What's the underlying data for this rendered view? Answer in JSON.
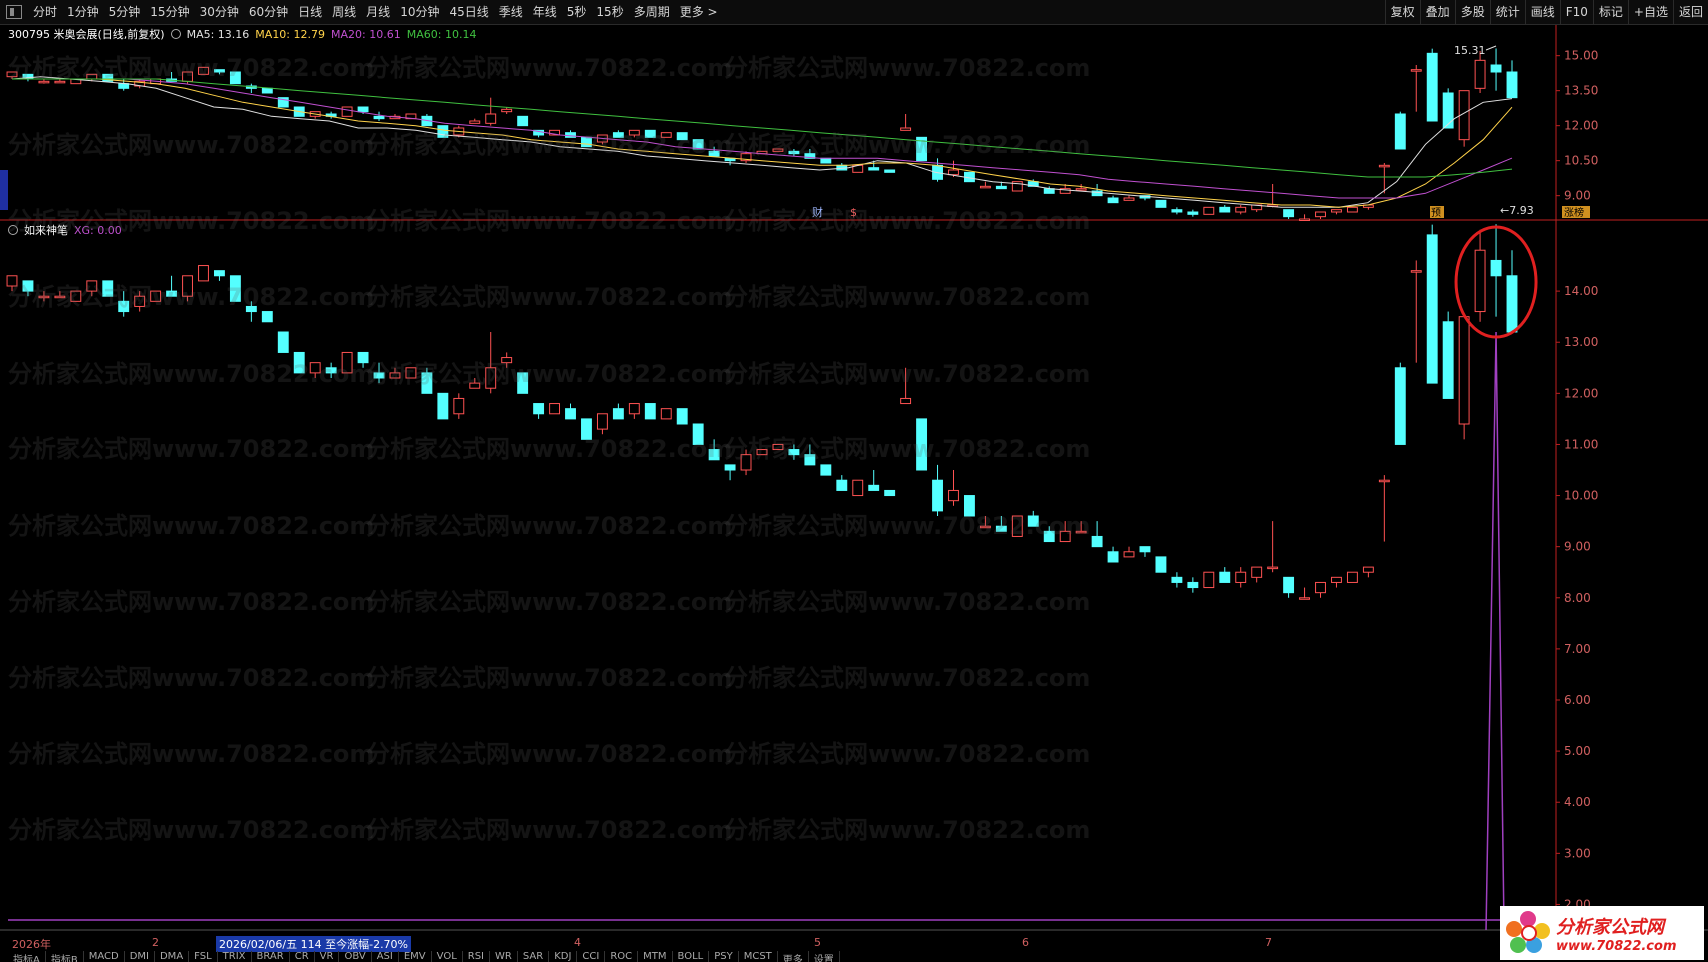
{
  "toolbar": {
    "periods": [
      "分时",
      "1分钟",
      "5分钟",
      "15分钟",
      "30分钟",
      "60分钟",
      "日线",
      "周线",
      "月线",
      "10分钟",
      "45日线",
      "季线",
      "年线",
      "5秒",
      "15秒",
      "多周期",
      "更多 >"
    ],
    "right": [
      "复权",
      "叠加",
      "多股",
      "统计",
      "画线",
      "F10",
      "标记",
      "+自选",
      "返回"
    ]
  },
  "stock": {
    "title": "300795 米奥会展(日线,前复权)",
    "ma5": "MA5: 13.16",
    "ma10": "MA10: 12.79",
    "ma20": "MA20: 10.61",
    "ma60": "MA60: 10.14"
  },
  "indicator": {
    "name": "如来神笔",
    "xg": "XG: 0.00"
  },
  "colors": {
    "up": "#ff5252",
    "down": "#54ffff",
    "ma5": "#e0e0e0",
    "ma10": "#ffd24a",
    "ma20": "#c050d0",
    "ma60": "#40c040",
    "grid": "#c02020",
    "purple": "#a040c0"
  },
  "annotations": {
    "high": "15.31",
    "low": "7.93",
    "cai": "财",
    "dollar": "$",
    "yu": "预",
    "zhangbang": "涨榜"
  },
  "date_strip": {
    "year": "2026年",
    "crosshair": "2026/02/06/五 114 至今涨幅-2.70%",
    "months": [
      "2",
      "4",
      "5",
      "6",
      "7"
    ]
  },
  "bottom_tabs": [
    "指标A",
    "指标B",
    "MACD",
    "DMI",
    "DMA",
    "FSL",
    "TRIX",
    "BRAR",
    "CR",
    "VR",
    "OBV",
    "ASI",
    "EMV",
    "VOL",
    "RSI",
    "WR",
    "SAR",
    "KDJ",
    "CCI",
    "ROC",
    "MTM",
    "BOLL",
    "PSY",
    "MCST",
    "更多",
    "设置"
  ],
  "logo": {
    "name": "分析家公式网",
    "url": "www.70822.com"
  },
  "watermark": "分析家公式网www.70822.com",
  "chart_data": [
    {
      "type": "candlestick",
      "ylim": [
        8.3,
        15.5
      ],
      "yticks": [
        "15.00",
        "13.50",
        "12.00",
        "10.50",
        "9.00"
      ],
      "series": [
        {
          "name": "MA5",
          "values": [
            14.0,
            14.1,
            14.0,
            13.9,
            13.8,
            13.6,
            13.2,
            12.8,
            12.7,
            12.4,
            12.3,
            12.2,
            11.9,
            11.9,
            11.8,
            11.6,
            11.5,
            11.4,
            11.3,
            11.1,
            11.0,
            10.9,
            10.7,
            10.6,
            10.5,
            10.4,
            10.3,
            10.2,
            10.1,
            10.2,
            10.5,
            10.4,
            10.0,
            9.8,
            9.6,
            9.5,
            9.3,
            9.2,
            9.1,
            9.0,
            8.9,
            8.8,
            8.7,
            8.6,
            8.5,
            8.5,
            8.5,
            8.7,
            9.6,
            11.2,
            12.3,
            13.0,
            13.16
          ]
        },
        {
          "name": "MA10",
          "values": [
            14.0,
            14.0,
            14.0,
            14.0,
            13.9,
            13.8,
            13.6,
            13.3,
            13.0,
            12.8,
            12.6,
            12.4,
            12.2,
            12.1,
            12.0,
            11.8,
            11.7,
            11.6,
            11.4,
            11.3,
            11.2,
            11.0,
            10.9,
            10.8,
            10.7,
            10.6,
            10.5,
            10.4,
            10.3,
            10.3,
            10.4,
            10.4,
            10.3,
            10.1,
            9.9,
            9.7,
            9.5,
            9.4,
            9.2,
            9.1,
            9.0,
            8.9,
            8.8,
            8.7,
            8.6,
            8.6,
            8.5,
            8.6,
            8.9,
            9.5,
            10.4,
            11.4,
            12.79
          ]
        },
        {
          "name": "MA20",
          "values": [
            14.0,
            14.0,
            14.0,
            14.0,
            14.0,
            13.9,
            13.8,
            13.6,
            13.4,
            13.2,
            13.0,
            12.8,
            12.6,
            12.4,
            12.3,
            12.1,
            12.0,
            11.9,
            11.8,
            11.6,
            11.5,
            11.4,
            11.3,
            11.1,
            11.0,
            10.9,
            10.8,
            10.7,
            10.6,
            10.6,
            10.6,
            10.5,
            10.4,
            10.3,
            10.2,
            10.1,
            10.0,
            9.9,
            9.7,
            9.6,
            9.5,
            9.4,
            9.3,
            9.2,
            9.1,
            9.0,
            8.9,
            8.9,
            8.9,
            9.1,
            9.6,
            10.1,
            10.61
          ]
        },
        {
          "name": "MA60",
          "values": [
            14.0,
            14.0,
            14.0,
            14.0,
            14.0,
            14.0,
            13.9,
            13.8,
            13.7,
            13.6,
            13.5,
            13.4,
            13.3,
            13.2,
            13.1,
            13.0,
            12.9,
            12.8,
            12.7,
            12.6,
            12.5,
            12.4,
            12.3,
            12.2,
            12.1,
            12.0,
            11.9,
            11.8,
            11.7,
            11.6,
            11.5,
            11.4,
            11.3,
            11.2,
            11.1,
            11.0,
            10.9,
            10.8,
            10.7,
            10.6,
            10.5,
            10.4,
            10.3,
            10.2,
            10.1,
            10.0,
            9.9,
            9.8,
            9.8,
            9.8,
            9.9,
            10.0,
            10.14
          ]
        }
      ]
    },
    {
      "type": "candlestick",
      "ylim": [
        1.5,
        15.0
      ],
      "yticks": [
        "14.00",
        "13.00",
        "12.00",
        "11.00",
        "10.00",
        "9.00",
        "8.00",
        "7.00",
        "6.00",
        "5.00",
        "4.00",
        "3.00",
        "2.00"
      ]
    }
  ],
  "candles": [
    [
      14.1,
      14.3,
      14.0,
      14.3
    ],
    [
      14.2,
      14.2,
      13.9,
      14.0
    ],
    [
      13.9,
      14.0,
      13.8,
      13.9
    ],
    [
      13.9,
      14.0,
      13.9,
      13.9
    ],
    [
      13.8,
      14.0,
      13.8,
      14.0
    ],
    [
      14.0,
      14.2,
      13.9,
      14.2
    ],
    [
      14.2,
      14.2,
      13.9,
      13.9
    ],
    [
      13.8,
      14.0,
      13.5,
      13.6
    ],
    [
      13.7,
      14.0,
      13.6,
      13.9
    ],
    [
      13.8,
      14.0,
      13.8,
      14.0
    ],
    [
      14.0,
      14.3,
      13.9,
      13.9
    ],
    [
      13.9,
      14.3,
      13.8,
      14.3
    ],
    [
      14.2,
      14.5,
      14.2,
      14.5
    ],
    [
      14.4,
      14.4,
      14.2,
      14.3
    ],
    [
      14.3,
      14.3,
      13.8,
      13.8
    ],
    [
      13.7,
      13.8,
      13.4,
      13.6
    ],
    [
      13.6,
      13.6,
      13.4,
      13.4
    ],
    [
      13.2,
      13.2,
      12.8,
      12.8
    ],
    [
      12.8,
      12.8,
      12.4,
      12.4
    ],
    [
      12.4,
      12.6,
      12.3,
      12.6
    ],
    [
      12.5,
      12.6,
      12.3,
      12.4
    ],
    [
      12.4,
      12.8,
      12.4,
      12.8
    ],
    [
      12.8,
      12.8,
      12.5,
      12.6
    ],
    [
      12.4,
      12.6,
      12.2,
      12.3
    ],
    [
      12.3,
      12.5,
      12.3,
      12.4
    ],
    [
      12.3,
      12.5,
      12.3,
      12.5
    ],
    [
      12.4,
      12.5,
      12.0,
      12.0
    ],
    [
      12.0,
      12.0,
      11.5,
      11.5
    ],
    [
      11.6,
      12.0,
      11.5,
      11.9
    ],
    [
      12.1,
      12.3,
      12.1,
      12.2
    ],
    [
      12.1,
      13.2,
      12.0,
      12.5
    ],
    [
      12.6,
      12.8,
      12.5,
      12.7
    ],
    [
      12.4,
      12.4,
      12.0,
      12.0
    ],
    [
      11.8,
      11.8,
      11.5,
      11.6
    ],
    [
      11.6,
      11.8,
      11.6,
      11.8
    ],
    [
      11.7,
      11.8,
      11.5,
      11.5
    ],
    [
      11.5,
      11.5,
      11.1,
      11.1
    ],
    [
      11.3,
      11.6,
      11.2,
      11.6
    ],
    [
      11.7,
      11.8,
      11.5,
      11.5
    ],
    [
      11.6,
      11.8,
      11.5,
      11.8
    ],
    [
      11.8,
      11.8,
      11.5,
      11.5
    ],
    [
      11.5,
      11.7,
      11.5,
      11.7
    ],
    [
      11.7,
      11.7,
      11.4,
      11.4
    ],
    [
      11.4,
      11.4,
      11.0,
      11.0
    ],
    [
      10.9,
      11.1,
      10.7,
      10.7
    ],
    [
      10.6,
      10.6,
      10.3,
      10.5
    ],
    [
      10.5,
      10.9,
      10.4,
      10.8
    ],
    [
      10.8,
      10.9,
      10.8,
      10.9
    ],
    [
      10.9,
      11.0,
      10.9,
      11.0
    ],
    [
      10.9,
      11.0,
      10.7,
      10.8
    ],
    [
      10.8,
      11.0,
      10.6,
      10.6
    ],
    [
      10.6,
      10.6,
      10.4,
      10.4
    ],
    [
      10.3,
      10.4,
      10.1,
      10.1
    ],
    [
      10.0,
      10.3,
      10.0,
      10.3
    ],
    [
      10.2,
      10.5,
      10.1,
      10.1
    ],
    [
      10.1,
      10.1,
      10.0,
      10.0
    ],
    [
      11.8,
      12.5,
      11.9,
      11.9
    ],
    [
      11.5,
      11.5,
      10.5,
      10.5
    ],
    [
      10.3,
      10.6,
      9.6,
      9.7
    ],
    [
      9.9,
      10.5,
      9.8,
      10.1
    ],
    [
      10.0,
      10.0,
      9.6,
      9.6
    ],
    [
      9.4,
      9.6,
      9.4,
      9.4
    ],
    [
      9.4,
      9.6,
      9.3,
      9.3
    ],
    [
      9.2,
      9.6,
      9.2,
      9.6
    ],
    [
      9.6,
      9.7,
      9.4,
      9.4
    ],
    [
      9.3,
      9.4,
      9.1,
      9.1
    ],
    [
      9.1,
      9.5,
      9.1,
      9.3
    ],
    [
      9.3,
      9.5,
      9.3,
      9.3
    ],
    [
      9.2,
      9.5,
      9.0,
      9.0
    ],
    [
      8.9,
      9.0,
      8.7,
      8.7
    ],
    [
      8.8,
      9.0,
      8.8,
      8.9
    ],
    [
      9.0,
      9.0,
      8.8,
      8.9
    ],
    [
      8.8,
      8.8,
      8.5,
      8.5
    ],
    [
      8.4,
      8.5,
      8.2,
      8.3
    ],
    [
      8.3,
      8.4,
      8.1,
      8.2
    ],
    [
      8.2,
      8.5,
      8.2,
      8.5
    ],
    [
      8.5,
      8.6,
      8.3,
      8.3
    ],
    [
      8.3,
      8.6,
      8.2,
      8.5
    ],
    [
      8.4,
      8.6,
      8.3,
      8.6
    ],
    [
      8.6,
      9.5,
      8.5,
      8.6
    ],
    [
      8.4,
      8.4,
      8.0,
      8.1
    ],
    [
      8.0,
      8.2,
      8.0,
      8.0
    ],
    [
      8.1,
      8.3,
      8.0,
      8.3
    ],
    [
      8.3,
      8.4,
      8.2,
      8.4
    ],
    [
      8.3,
      8.5,
      8.3,
      8.5
    ],
    [
      8.5,
      8.6,
      8.4,
      8.6
    ],
    [
      10.3,
      10.4,
      9.1,
      10.3
    ],
    [
      12.5,
      12.6,
      11.0,
      11.0
    ],
    [
      14.4,
      14.6,
      12.6,
      14.4
    ],
    [
      15.1,
      15.3,
      12.2,
      12.2
    ],
    [
      13.4,
      13.6,
      11.9,
      11.9
    ],
    [
      11.4,
      13.5,
      11.1,
      13.5
    ],
    [
      13.6,
      15.2,
      13.4,
      14.8
    ],
    [
      14.6,
      15.31,
      13.5,
      14.3
    ],
    [
      14.3,
      14.8,
      13.6,
      13.2
    ]
  ]
}
